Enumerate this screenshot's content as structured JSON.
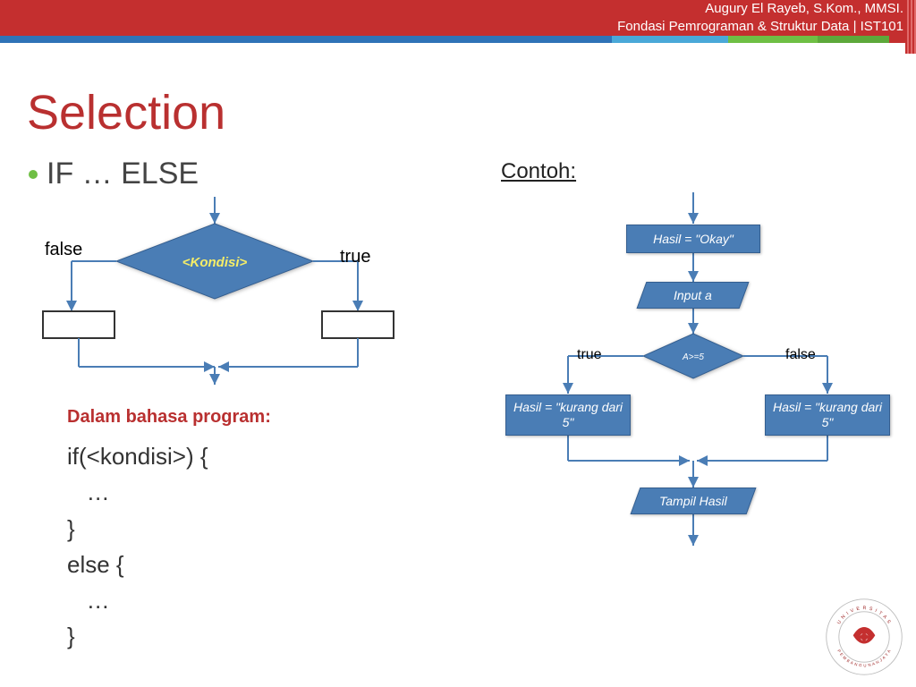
{
  "header": {
    "author": "Augury El Rayeb, S.Kom., MMSI.",
    "course": "Fondasi Pemrograman & Struktur Data | IST101"
  },
  "title": "Selection",
  "subhead": "IF … ELSE",
  "example_label": "Contoh:",
  "left_chart": {
    "false_label": "false",
    "true_label": "true",
    "cond": "<Kondisi>"
  },
  "code_section": {
    "label": "Dalam bahasa program:",
    "code": "if(<kondisi>) {\n   …\n}\nelse {\n   …\n}"
  },
  "right_chart": {
    "step1": "Hasil = \"Okay\"",
    "step2": "Input  a",
    "cond": "A>=5",
    "true_label": "true",
    "false_label": "false",
    "true_branch": "Hasil = \"kurang dari 5\"",
    "false_branch": "Hasil = \"kurang dari 5\"",
    "output": "Tampil Hasil"
  },
  "logo": {
    "outer": "U N I V E R S I T A S",
    "outer2": "P E M B A N G U N A N   J A Y A"
  }
}
